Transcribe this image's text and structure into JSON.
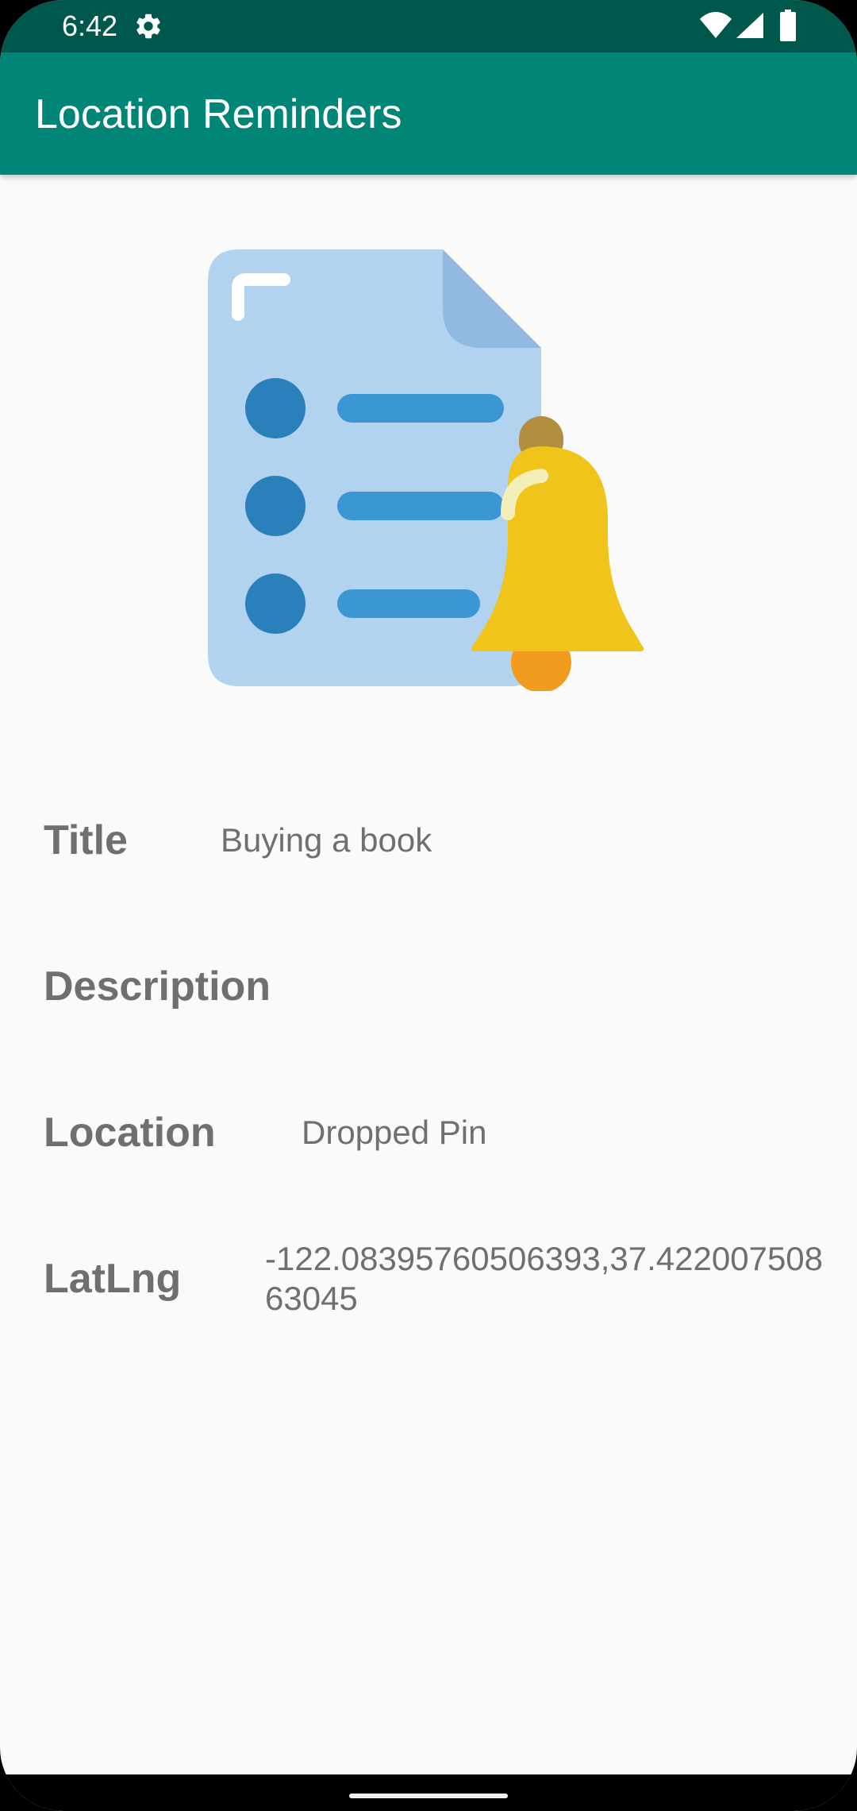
{
  "status_bar": {
    "time": "6:42",
    "icons": [
      "gear-icon",
      "wifi-icon",
      "signal-icon",
      "battery-icon"
    ],
    "background": "#00574b"
  },
  "app_bar": {
    "title": "Location Reminders",
    "background": "#008577"
  },
  "illustration": {
    "icon": "reminder-document-bell-icon"
  },
  "details": {
    "title_label": "Title",
    "title_value": "Buying a book",
    "description_label": "Description",
    "description_value": "",
    "location_label": "Location",
    "location_value": "Dropped Pin",
    "latlng_label": "LatLng",
    "latlng_value": "-122.08395760506393,37.42200750863045"
  },
  "colors": {
    "label_text": "#6f6f6f",
    "screen_background": "#fafafa"
  }
}
